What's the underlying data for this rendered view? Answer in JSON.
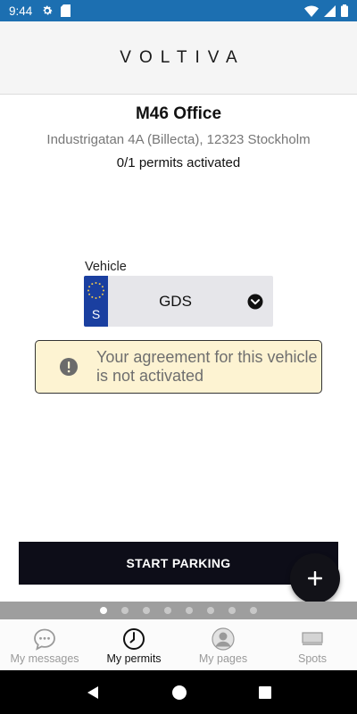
{
  "status_bar": {
    "time": "9:44",
    "icons": [
      "gear-icon",
      "sd-card-icon",
      "wifi-icon",
      "cell-signal-icon",
      "battery-icon"
    ]
  },
  "header": {
    "logo": "VOLTIVA"
  },
  "location": {
    "title": "M46 Office",
    "address": "Industrigatan 4A (Billecta), 12323 Stockholm",
    "permits": "0/1 permits activated"
  },
  "vehicle": {
    "label": "Vehicle",
    "country_code": "S",
    "registration": "GDS"
  },
  "alert": {
    "text": "Your agreement for this vehicle is not activated"
  },
  "actions": {
    "start_parking": "START PARKING",
    "fab": "+"
  },
  "pager": {
    "count": 8,
    "active_index": 0
  },
  "tabs": [
    {
      "label": "My messages",
      "icon": "chat-bubble-icon",
      "active": false
    },
    {
      "label": "My permits",
      "icon": "clock-icon",
      "active": true
    },
    {
      "label": "My pages",
      "icon": "person-icon",
      "active": false
    },
    {
      "label": "Spots",
      "icon": "parking-spot-icon",
      "active": false
    }
  ],
  "colors": {
    "status_bar": "#1c6fb1",
    "alert_bg": "#fdf3d2",
    "button": "#0d0d18",
    "plate_eu": "#1a3fa0"
  }
}
